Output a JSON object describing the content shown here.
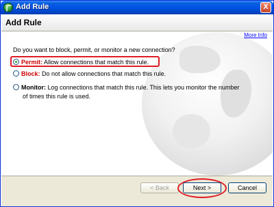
{
  "window": {
    "title": "Add Rule",
    "close_label": "X"
  },
  "header": {
    "title": "Add Rule"
  },
  "content": {
    "more_info": "More Info",
    "question": "Do you want to block, permit, or monitor a new connection?",
    "options": [
      {
        "label": "Permit:",
        "description": "Allow connections that match this rule.",
        "selected": true
      },
      {
        "label": "Block:",
        "description": "Do not allow connections that match this rule.",
        "selected": false
      },
      {
        "label": "Monitor:",
        "description": "Log connections that match this rule. This lets you monitor the number",
        "description_cont": "of times this rule is used.",
        "selected": false
      }
    ]
  },
  "footer": {
    "back_label": "< Back",
    "next_label": "Next >",
    "cancel_label": "Cancel"
  }
}
